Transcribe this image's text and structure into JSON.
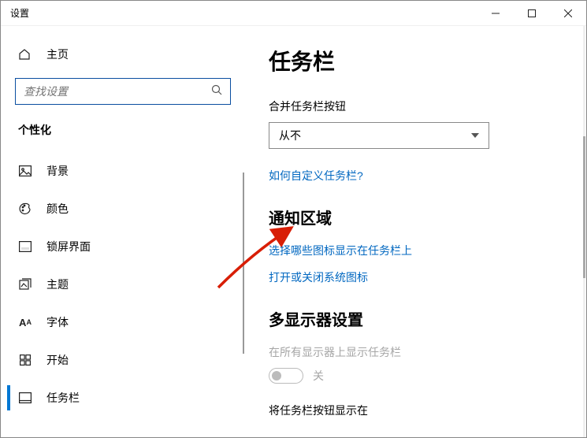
{
  "titlebar": {
    "label": "设置"
  },
  "sidebar": {
    "home": "主页",
    "search_placeholder": "查找设置",
    "section": "个性化",
    "items": [
      {
        "label": "背景"
      },
      {
        "label": "颜色"
      },
      {
        "label": "锁屏界面"
      },
      {
        "label": "主题"
      },
      {
        "label": "字体"
      },
      {
        "label": "开始"
      },
      {
        "label": "任务栏"
      }
    ]
  },
  "main": {
    "title": "任务栏",
    "combine_label": "合并任务栏按钮",
    "combine_value": "从不",
    "customize_link": "如何自定义任务栏?",
    "notify_heading": "通知区域",
    "icons_link": "选择哪些图标显示在任务栏上",
    "system_icons_link": "打开或关闭系统图标",
    "multimon_heading": "多显示器设置",
    "multimon_text": "在所有显示器上显示任务栏",
    "toggle_state": "关",
    "show_buttons_label": "将任务栏按钮显示在"
  }
}
